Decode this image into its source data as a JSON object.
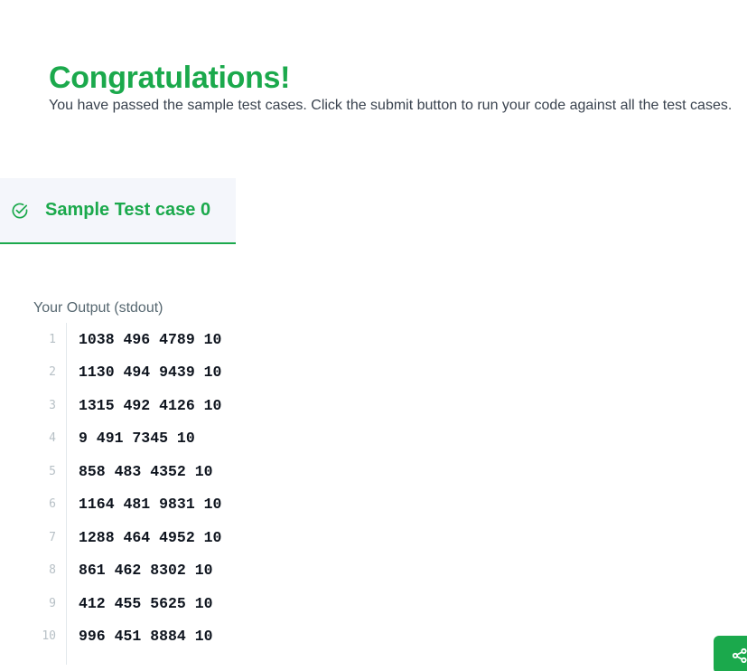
{
  "header": {
    "title": "Congratulations!",
    "message": "You have passed the sample test cases. Click the submit button to run your code against all the test cases."
  },
  "testcase_tab": {
    "label": "Sample Test case 0",
    "status_icon": "check-circle-icon",
    "status": "passed"
  },
  "output": {
    "label": "Your Output (stdout)",
    "lines": [
      {
        "number": "1",
        "text": "1038 496 4789 10"
      },
      {
        "number": "2",
        "text": "1130 494 9439 10"
      },
      {
        "number": "3",
        "text": "1315 492 4126 10"
      },
      {
        "number": "4",
        "text": "9 491 7345 10"
      },
      {
        "number": "5",
        "text": "858 483 4352 10"
      },
      {
        "number": "6",
        "text": "1164 481 9831 10"
      },
      {
        "number": "7",
        "text": "1288 464 4952 10"
      },
      {
        "number": "8",
        "text": "861 462 8302 10"
      },
      {
        "number": "9",
        "text": "412 455 5625 10"
      },
      {
        "number": "10",
        "text": "996 451 8884 10"
      }
    ]
  },
  "share_button": {
    "icon": "share-icon"
  },
  "colors": {
    "accent": "#1ba94c",
    "text": "#39424e",
    "tab_background": "#f4f6fb"
  }
}
